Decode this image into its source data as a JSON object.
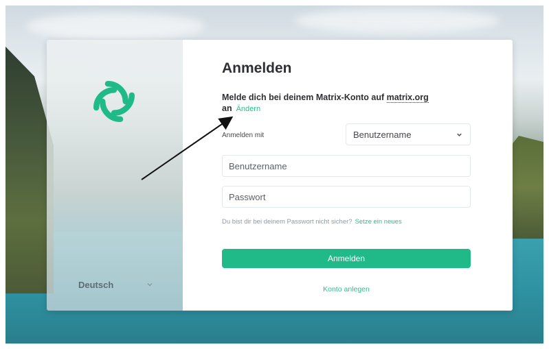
{
  "colors": {
    "accent": "#1fba87",
    "link": "#2bbf8a",
    "title": "#2e2f32",
    "muted": "#8d99a5"
  },
  "branding": {
    "logo_icon": "element-logo-icon"
  },
  "language": {
    "selected": "Deutsch",
    "icon": "chevron-down-icon"
  },
  "login": {
    "title": "Anmelden",
    "subtitle_prefix": "Melde dich bei deinem Matrix-Konto auf ",
    "server": "matrix.org",
    "subtitle_suffix": " an",
    "change_link": "Ändern",
    "login_with_label": "Anmelden mit",
    "login_with_selected": "Benutzername",
    "username_placeholder": "Benutzername",
    "password_placeholder": "Passwort",
    "forgot_text": "Du bist dir bei deinem Passwort nicht sicher?",
    "reset_link": "Setze ein neues",
    "signin_button": "Anmelden",
    "create_account_link": "Konto anlegen"
  }
}
